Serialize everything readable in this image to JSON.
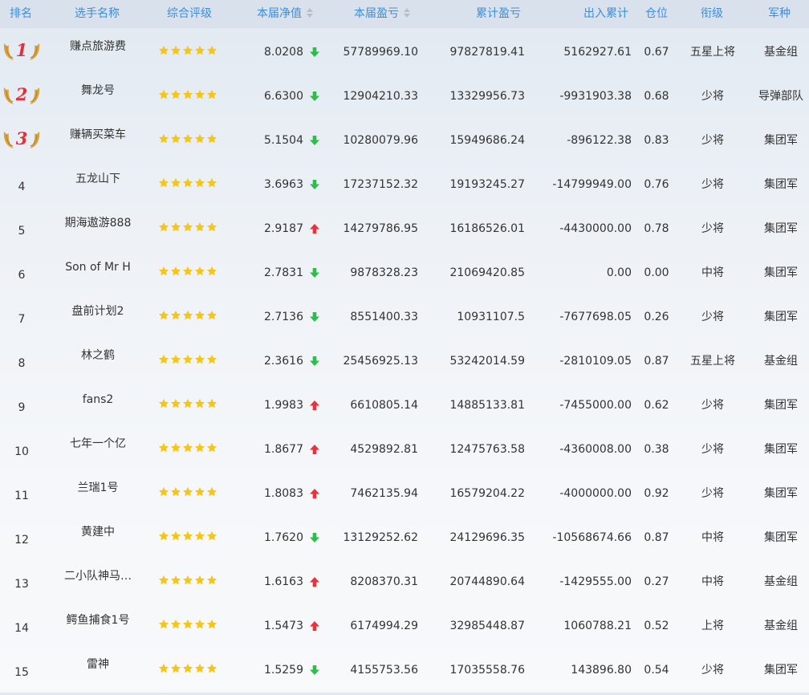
{
  "table": {
    "columns": {
      "rank": "排名",
      "name": "选手名称",
      "rating": "综合评级",
      "nav": "本届净值",
      "current_pnl": "本届盈亏",
      "cumulative_pnl": "累计盈亏",
      "net_flow": "出入累计",
      "position": "仓位",
      "title": "衔级",
      "corps": "军种"
    },
    "sortable_columns": [
      "nav",
      "current_pnl"
    ],
    "colors": {
      "header_bg": "#d9e2ec",
      "header_text": "#3d8ddc",
      "star": "#f5c518",
      "arrow_up": "#e8323c",
      "arrow_down": "#2dbd4a",
      "medal_gold": "#d9a441",
      "medal_number": "#e0303a"
    },
    "rows": [
      {
        "rank": "1",
        "medal": true,
        "name": "赚点旅游费",
        "stars": 5,
        "nav": "8.0208",
        "trend": "down",
        "current_pnl": "57789969.10",
        "cumulative_pnl": "97827819.41",
        "net_flow": "5162927.61",
        "position": "0.67",
        "title": "五星上将",
        "corps": "基金组"
      },
      {
        "rank": "2",
        "medal": true,
        "name": "舞龙号",
        "stars": 5,
        "nav": "6.6300",
        "trend": "down",
        "current_pnl": "12904210.33",
        "cumulative_pnl": "13329956.73",
        "net_flow": "-9931903.38",
        "position": "0.68",
        "title": "少将",
        "corps": "导弹部队"
      },
      {
        "rank": "3",
        "medal": true,
        "name": "赚辆买菜车",
        "stars": 5,
        "nav": "5.1504",
        "trend": "down",
        "current_pnl": "10280079.96",
        "cumulative_pnl": "15949686.24",
        "net_flow": "-896122.38",
        "position": "0.83",
        "title": "少将",
        "corps": "集团军"
      },
      {
        "rank": "4",
        "medal": false,
        "name": "五龙山下",
        "stars": 5,
        "nav": "3.6963",
        "trend": "down",
        "current_pnl": "17237152.32",
        "cumulative_pnl": "19193245.27",
        "net_flow": "-14799949.00",
        "position": "0.76",
        "title": "少将",
        "corps": "集团军"
      },
      {
        "rank": "5",
        "medal": false,
        "name": "期海遨游888",
        "stars": 5,
        "nav": "2.9187",
        "trend": "up",
        "current_pnl": "14279786.95",
        "cumulative_pnl": "16186526.01",
        "net_flow": "-4430000.00",
        "position": "0.78",
        "title": "少将",
        "corps": "集团军"
      },
      {
        "rank": "6",
        "medal": false,
        "name": "Son of Mr H",
        "stars": 5,
        "nav": "2.7831",
        "trend": "down",
        "current_pnl": "9878328.23",
        "cumulative_pnl": "21069420.85",
        "net_flow": "0.00",
        "position": "0.00",
        "title": "中将",
        "corps": "集团军"
      },
      {
        "rank": "7",
        "medal": false,
        "name": "盘前计划2",
        "stars": 5,
        "nav": "2.7136",
        "trend": "down",
        "current_pnl": "8551400.33",
        "cumulative_pnl": "10931107.5",
        "net_flow": "-7677698.05",
        "position": "0.26",
        "title": "少将",
        "corps": "集团军"
      },
      {
        "rank": "8",
        "medal": false,
        "name": "林之鹤",
        "stars": 5,
        "nav": "2.3616",
        "trend": "down",
        "current_pnl": "25456925.13",
        "cumulative_pnl": "53242014.59",
        "net_flow": "-2810109.05",
        "position": "0.87",
        "title": "五星上将",
        "corps": "基金组"
      },
      {
        "rank": "9",
        "medal": false,
        "name": "fans2",
        "stars": 5,
        "nav": "1.9983",
        "trend": "up",
        "current_pnl": "6610805.14",
        "cumulative_pnl": "14885133.81",
        "net_flow": "-7455000.00",
        "position": "0.62",
        "title": "少将",
        "corps": "集团军"
      },
      {
        "rank": "10",
        "medal": false,
        "name": "七年一个亿",
        "stars": 5,
        "nav": "1.8677",
        "trend": "up",
        "current_pnl": "4529892.81",
        "cumulative_pnl": "12475763.58",
        "net_flow": "-4360008.00",
        "position": "0.38",
        "title": "少将",
        "corps": "集团军"
      },
      {
        "rank": "11",
        "medal": false,
        "name": "兰瑞1号",
        "stars": 5,
        "nav": "1.8083",
        "trend": "up",
        "current_pnl": "7462135.94",
        "cumulative_pnl": "16579204.22",
        "net_flow": "-4000000.00",
        "position": "0.92",
        "title": "少将",
        "corps": "集团军"
      },
      {
        "rank": "12",
        "medal": false,
        "name": "黄建中",
        "stars": 5,
        "nav": "1.7620",
        "trend": "down",
        "current_pnl": "13129252.62",
        "cumulative_pnl": "24129696.35",
        "net_flow": "-10568674.66",
        "position": "0.87",
        "title": "中将",
        "corps": "集团军"
      },
      {
        "rank": "13",
        "medal": false,
        "name": "二小队神马…",
        "stars": 5,
        "nav": "1.6163",
        "trend": "up",
        "current_pnl": "8208370.31",
        "cumulative_pnl": "20744890.64",
        "net_flow": "-1429555.00",
        "position": "0.27",
        "title": "中将",
        "corps": "基金组"
      },
      {
        "rank": "14",
        "medal": false,
        "name": "鳄鱼捕食1号",
        "stars": 5,
        "nav": "1.5473",
        "trend": "up",
        "current_pnl": "6174994.29",
        "cumulative_pnl": "32985448.87",
        "net_flow": "1060788.21",
        "position": "0.52",
        "title": "上将",
        "corps": "基金组"
      },
      {
        "rank": "15",
        "medal": false,
        "name": "雷神",
        "stars": 5,
        "nav": "1.5259",
        "trend": "down",
        "current_pnl": "4155753.56",
        "cumulative_pnl": "17035558.76",
        "net_flow": "143896.80",
        "position": "0.54",
        "title": "少将",
        "corps": "集团军"
      }
    ]
  }
}
